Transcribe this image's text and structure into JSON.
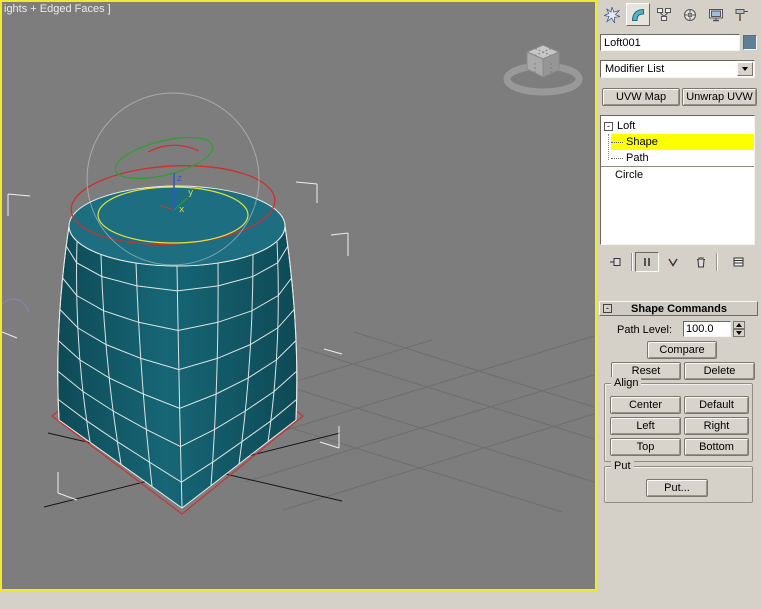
{
  "colors": {
    "viewport_bg": "#7d7d7d",
    "active_border": "#f0ea2d",
    "panel_bg": "#d5d1c8",
    "object_body": "#166676",
    "object_body_dark": "#0e4a56",
    "object_top": "#1c6e80",
    "wire": "#e9ecec",
    "selection_yellow": "#ffff00",
    "shape_circle_red": "#cd2f2f",
    "shape_circle_yellow": "#e3e33a",
    "shape_circle_green": "#2da12d",
    "axis_z_blue": "#2f52d8",
    "object_swatch": "#5e7f96"
  },
  "viewport": {
    "shading_label": "ights + Edged Faces ]"
  },
  "command_panel": {
    "tabs": [
      {
        "name": "Create"
      },
      {
        "name": "Modify",
        "selected": true
      },
      {
        "name": "Hierarchy"
      },
      {
        "name": "Motion"
      },
      {
        "name": "Display"
      },
      {
        "name": "Utilities"
      }
    ],
    "object_name": "Loft001",
    "modifier_dropdown_value": "Modifier List",
    "uvw_map_button": "UVW Map",
    "unwrap_uvw_button": "Unwrap UVW",
    "modifier_stack": [
      {
        "label": "Loft",
        "expander": "-"
      },
      {
        "label": "Shape",
        "selected": true
      },
      {
        "label": "Path"
      },
      {
        "label": "Circle"
      }
    ],
    "stack_tools": [
      "pin-stack",
      "show-end-result",
      "make-unique",
      "remove-modifier",
      "configure-modifier-sets"
    ],
    "rollout": {
      "collapse_glyph": "-",
      "title": "Shape Commands",
      "path_level_label": "Path Level:",
      "path_level_value": "100.0",
      "compare_button": "Compare",
      "reset_button": "Reset",
      "delete_button": "Delete",
      "align_group_label": "Align",
      "align_buttons": [
        "Center",
        "Default",
        "Left",
        "Right",
        "Top",
        "Bottom"
      ],
      "put_group_label": "Put",
      "put_button": "Put..."
    }
  }
}
